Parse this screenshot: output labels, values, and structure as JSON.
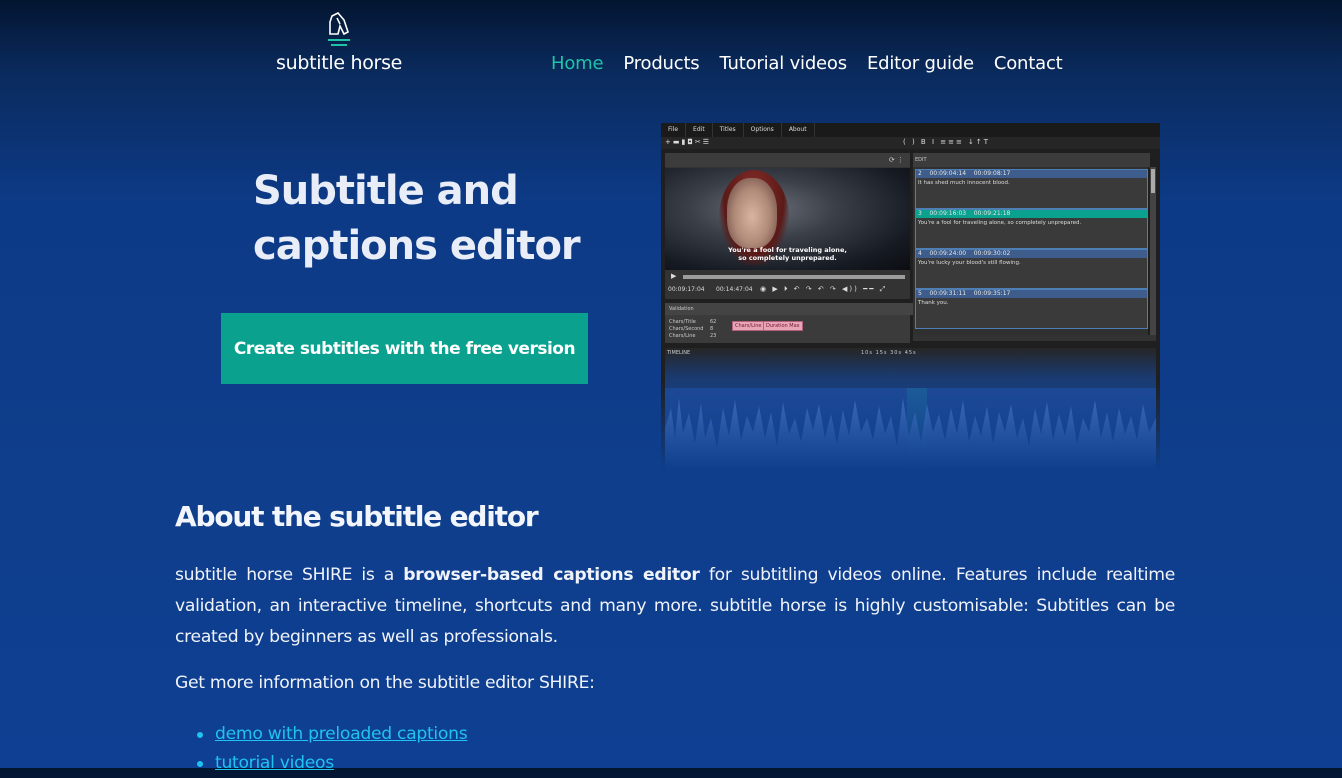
{
  "header": {
    "logo_text": "subtitle horse",
    "nav": [
      {
        "label": "Home",
        "active": true
      },
      {
        "label": "Products",
        "active": false
      },
      {
        "label": "Tutorial videos",
        "active": false
      },
      {
        "label": "Editor guide",
        "active": false
      },
      {
        "label": "Contact",
        "active": false
      }
    ]
  },
  "hero": {
    "title_line1": "Subtitle and",
    "title_line2": "captions editor",
    "cta_label": "Create subtitles with the free version"
  },
  "screenshot": {
    "menu": [
      "File",
      "Edit",
      "Titles",
      "Options",
      "About"
    ],
    "video_subtitle_line1": "You're a fool for traveling alone,",
    "video_subtitle_line2": "so completely unprepared.",
    "time_current": "00:09:17:04",
    "time_total": "00:14:47:04",
    "validation_title": "Validation",
    "validation_rows": [
      "Chars/Title",
      "Chars/Second",
      "Chars/Line"
    ],
    "validation_values": [
      "62",
      "8",
      "23"
    ],
    "validation_buttons": [
      "Chars/Line",
      "Duration Max"
    ],
    "edit_title": "EDIT",
    "cues": [
      {
        "num": "2",
        "start": "00:09:04:14",
        "end": "00:09:08:17",
        "text": "It has shed much innocent blood."
      },
      {
        "num": "3",
        "start": "00:09:16:03",
        "end": "00:09:21:18",
        "text": "You're a fool for traveling alone, so completely unprepared.",
        "selected": true
      },
      {
        "num": "4",
        "start": "00:09:24:00",
        "end": "00:09:30:02",
        "text": "You're lucky your blood's still flowing."
      },
      {
        "num": "5",
        "start": "00:09:31:11",
        "end": "00:09:35:17",
        "text": "Thank you."
      }
    ],
    "timeline_title": "TIMELINE",
    "zoom_levels": [
      "10s",
      "15s",
      "30s",
      "45s"
    ]
  },
  "about": {
    "title": "About the subtitle editor",
    "text_prefix": "subtitle horse SHIRE is a ",
    "text_bold": "browser-based captions editor",
    "text_suffix": " for subtitling videos online. Features include realtime validation, an interactive timeline, shortcuts and many more. subtitle horse is highly customisable: Subtitles can be created by beginners as well as professionals.",
    "more_info": "Get more information on the subtitle editor SHIRE:",
    "links": [
      "demo with preloaded captions",
      "tutorial videos"
    ]
  },
  "colors": {
    "accent": "#20c3a8",
    "cta": "#0aa18f",
    "link": "#20c3ed",
    "background": "#0f3e8c"
  }
}
